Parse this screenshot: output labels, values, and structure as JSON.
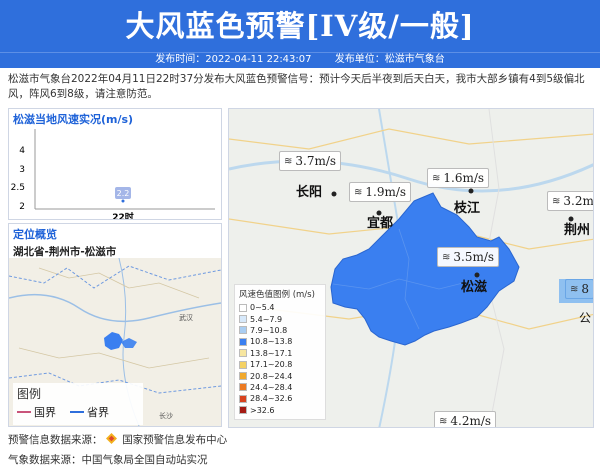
{
  "header": {
    "title": "大风蓝色预警[IV级/一般]",
    "publish_time_label": "发布时间：2022-04-11 22:43:07",
    "publisher_label": "发布单位：松滋市气象台"
  },
  "description": "松滋市气象台2022年04月11日22时37分发布大风蓝色预警信号：预计今天后半夜到后天白天，我市大部乡镇有4到5级偏北风，阵风6到8级，请注意防范。",
  "wind_panel": {
    "title": "松滋当地风速实况(m/s)",
    "chart_data": {
      "type": "bar",
      "categories": [
        "22时"
      ],
      "values": [
        2.2
      ],
      "value_labels": [
        "2.2"
      ],
      "yticks": [
        "4",
        "3",
        "2.5",
        "2"
      ],
      "ylim": [
        2,
        4
      ]
    }
  },
  "location_panel": {
    "title": "定位概览",
    "path": "湖北省-荆州市-松滋市",
    "legend_title": "图例",
    "legend_items": [
      {
        "label": "国界",
        "color": "#c9547a"
      },
      {
        "label": "省界",
        "color": "#2f6fdc"
      }
    ],
    "place_labels": [
      "武汉",
      "长沙"
    ]
  },
  "main_map": {
    "legend": {
      "title": "风速色值图例 (m/s)",
      "items": [
        {
          "label": "0~5.4",
          "color": "#ffffff"
        },
        {
          "label": "5.4~7.9",
          "color": "#d7e9fb"
        },
        {
          "label": "7.9~10.8",
          "color": "#a9cdf2"
        },
        {
          "label": "10.8~13.8",
          "color": "#3a7ff0"
        },
        {
          "label": "13.8~17.1",
          "color": "#f7e6a0"
        },
        {
          "label": "17.1~20.8",
          "color": "#f4d163"
        },
        {
          "label": "20.8~24.4",
          "color": "#f1a92d"
        },
        {
          "label": "24.4~28.4",
          "color": "#ec7a22"
        },
        {
          "label": "28.4~32.6",
          "color": "#d8431f"
        },
        {
          ">label": "",
          "label": ">32.6",
          "color": "#a51b14"
        }
      ]
    },
    "wind_tags": [
      "3.7m/s",
      "1.9m/s",
      "1.6m/s",
      "3.2m/s",
      "3.5m/s",
      "4.2m/s",
      "8"
    ],
    "cities": [
      "长阳",
      "宜都",
      "枝江",
      "荆州",
      "松滋",
      "公"
    ]
  },
  "footer": {
    "warning_source_label": "预警信息数据来源：",
    "warning_source_name": "国家预警信息发布中心",
    "weather_source_label": "气象数据来源：中国气象局全国自动站实况"
  },
  "colors": {
    "brand_blue": "#2f6fdc",
    "region_blue": "#3a7ff0",
    "panel_title_blue": "#1e62d8"
  }
}
